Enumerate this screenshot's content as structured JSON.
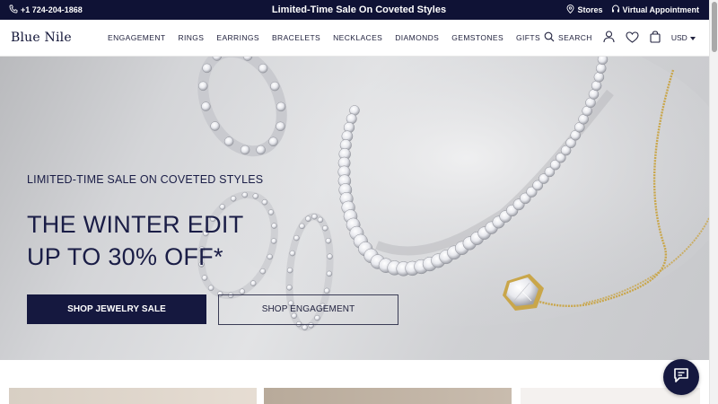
{
  "topbar": {
    "phone": "+1 724-204-1868",
    "promo": "Limited-Time Sale On Coveted Styles",
    "stores": "Stores",
    "appointment": "Virtual Appointment"
  },
  "header": {
    "logo": "Blue Nile",
    "nav": [
      "ENGAGEMENT",
      "RINGS",
      "EARRINGS",
      "BRACELETS",
      "NECKLACES",
      "DIAMONDS",
      "GEMSTONES",
      "GIFTS"
    ],
    "search_label": "SEARCH",
    "currency": "USD"
  },
  "hero": {
    "eyebrow": "LIMITED-TIME SALE ON COVETED STYLES",
    "headline_line1": "THE WINTER EDIT",
    "headline_line2": "UP TO 30% OFF*",
    "primary_cta": "SHOP JEWELRY SALE",
    "secondary_cta": "SHOP ENGAGEMENT"
  },
  "colors": {
    "navy": "#15183f",
    "gold": "#c9a64a",
    "silver": "#e9eaee"
  },
  "icons": [
    "phone-icon",
    "location-pin-icon",
    "headset-icon",
    "search-icon",
    "user-icon",
    "heart-icon",
    "bag-icon",
    "chevron-down-icon",
    "chat-icon"
  ]
}
